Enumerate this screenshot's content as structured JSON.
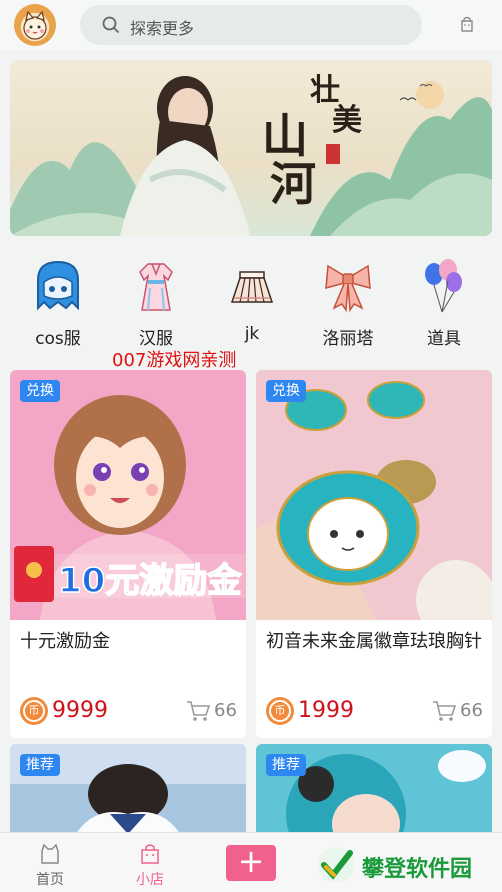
{
  "header": {
    "avatar": "cartoon-avatar",
    "search_placeholder": "探索更多",
    "search_icon": "search-icon",
    "bag_icon": "bag-icon"
  },
  "banner": {
    "title_chars": [
      "壮",
      "美",
      "山",
      "河"
    ],
    "seal": "印"
  },
  "categories": [
    {
      "label": "cos服",
      "icon": "ghost-icon"
    },
    {
      "label": "汉服",
      "icon": "hanfu-dress-icon"
    },
    {
      "label": "jk",
      "icon": "pleated-skirt-icon"
    },
    {
      "label": "洛丽塔",
      "icon": "bow-icon"
    },
    {
      "label": "道具",
      "icon": "balloons-icon"
    }
  ],
  "watermark_text": "007游戏网亲测",
  "products": [
    {
      "badge": "兑换",
      "title": "十元激励金",
      "image_text": "10元激励金",
      "price": "9999",
      "coin": "币",
      "sales": "66"
    },
    {
      "badge": "兑换",
      "title": "初音未来金属徽章珐琅胸针",
      "price": "1999",
      "coin": "币",
      "sales": "66"
    },
    {
      "badge": "推荐"
    },
    {
      "badge": "推荐"
    }
  ],
  "bottom_nav": {
    "home": "首页",
    "shop": "小店",
    "plus": "+",
    "active_color": "#f0628b"
  },
  "brand_watermark": "攀登软件园",
  "colors": {
    "badge_blue": "#2e86f0",
    "price_red": "#d0101a",
    "coin_orange": "#f28a3b"
  }
}
